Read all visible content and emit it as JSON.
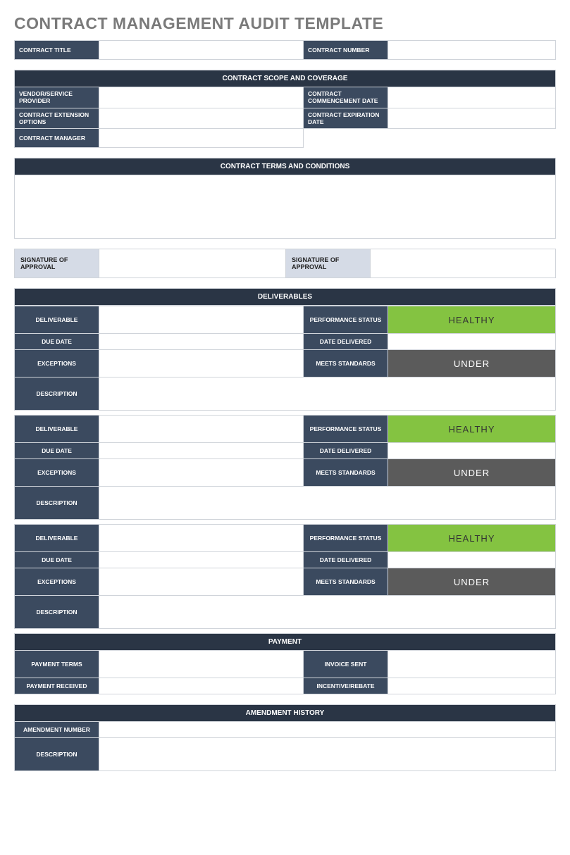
{
  "title": "CONTRACT MANAGEMENT AUDIT TEMPLATE",
  "header_row": {
    "contract_title": "CONTRACT TITLE",
    "contract_number": "CONTRACT NUMBER"
  },
  "scope": {
    "header": "CONTRACT SCOPE AND COVERAGE",
    "vendor": "VENDOR/SERVICE PROVIDER",
    "commence": "CONTRACT COMMENCEMENT DATE",
    "extension": "CONTRACT EXTENSION OPTIONS",
    "expiration": "CONTRACT EXPIRATION DATE",
    "manager": "CONTRACT MANAGER"
  },
  "terms": {
    "header": "CONTRACT TERMS AND CONDITIONS"
  },
  "signature": {
    "label": "SIGNATURE OF APPROVAL"
  },
  "deliverables": {
    "header": "DELIVERABLES",
    "labels": {
      "deliverable": "DELIVERABLE",
      "perf_status": "PERFORMANCE STATUS",
      "due_date": "DUE DATE",
      "date_delivered": "DATE DELIVERED",
      "exceptions": "EXCEPTIONS",
      "meets_standards": "MEETS STANDARDS",
      "description": "DESCRIPTION"
    },
    "items": [
      {
        "perf_status": "HEALTHY",
        "meets_standards": "UNDER"
      },
      {
        "perf_status": "HEALTHY",
        "meets_standards": "UNDER"
      },
      {
        "perf_status": "HEALTHY",
        "meets_standards": "UNDER"
      }
    ]
  },
  "payment": {
    "header": "PAYMENT",
    "terms": "PAYMENT TERMS",
    "invoice": "INVOICE SENT",
    "received": "PAYMENT RECEIVED",
    "incentive": "INCENTIVE/REBATE"
  },
  "amendment": {
    "header": "AMENDMENT HISTORY",
    "number": "AMENDMENT NUMBER",
    "description": "DESCRIPTION"
  }
}
